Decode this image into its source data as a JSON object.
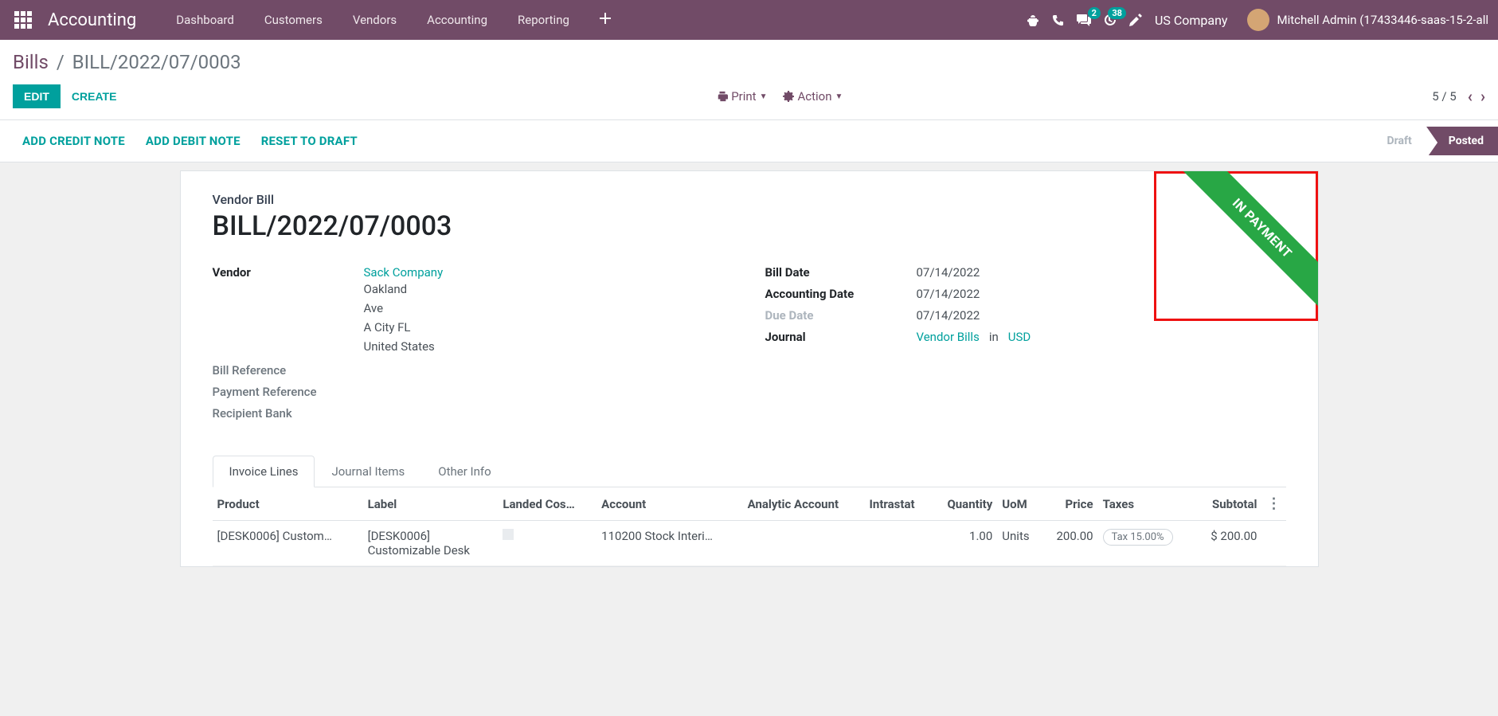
{
  "navbar": {
    "brand": "Accounting",
    "links": [
      "Dashboard",
      "Customers",
      "Vendors",
      "Accounting",
      "Reporting"
    ],
    "messages_badge": "2",
    "activities_badge": "38",
    "company": "US Company",
    "user": "Mitchell Admin (17433446-saas-15-2-all"
  },
  "breadcrumb": {
    "parent": "Bills",
    "current": "BILL/2022/07/0003"
  },
  "cp": {
    "edit": "Edit",
    "create": "Create",
    "print": "Print",
    "action": "Action",
    "pager": "5 / 5"
  },
  "statusbar": {
    "actions": [
      "Add Credit Note",
      "Add Debit Note",
      "Reset to Draft"
    ],
    "draft": "Draft",
    "posted": "Posted"
  },
  "ribbon": "IN PAYMENT",
  "doc": {
    "type": "Vendor Bill",
    "title": "BILL/2022/07/0003"
  },
  "labels": {
    "vendor": "Vendor",
    "bill_reference": "Bill Reference",
    "payment_reference": "Payment Reference",
    "recipient_bank": "Recipient Bank",
    "bill_date": "Bill Date",
    "accounting_date": "Accounting Date",
    "due_date": "Due Date",
    "journal": "Journal"
  },
  "vendor": {
    "name": "Sack Company",
    "addr1": "Oakland",
    "addr2": "Ave",
    "addr3": "A City FL",
    "addr4": "United States"
  },
  "dates": {
    "bill_date": "07/14/2022",
    "accounting_date": "07/14/2022",
    "due_date": "07/14/2022"
  },
  "journal": {
    "name": "Vendor Bills",
    "connector": "in",
    "currency": "USD"
  },
  "tabs": [
    "Invoice Lines",
    "Journal Items",
    "Other Info"
  ],
  "table": {
    "headers": {
      "product": "Product",
      "label": "Label",
      "landed": "Landed Cos…",
      "account": "Account",
      "analytic": "Analytic Account",
      "intrastat": "Intrastat",
      "quantity": "Quantity",
      "uom": "UoM",
      "price": "Price",
      "taxes": "Taxes",
      "subtotal": "Subtotal"
    },
    "rows": [
      {
        "product": "[DESK0006] Custom…",
        "label1": "[DESK0006]",
        "label2": "Customizable Desk",
        "account": "110200 Stock Interi…",
        "quantity": "1.00",
        "uom": "Units",
        "price": "200.00",
        "tax": "Tax 15.00%",
        "subtotal": "$ 200.00"
      }
    ]
  }
}
